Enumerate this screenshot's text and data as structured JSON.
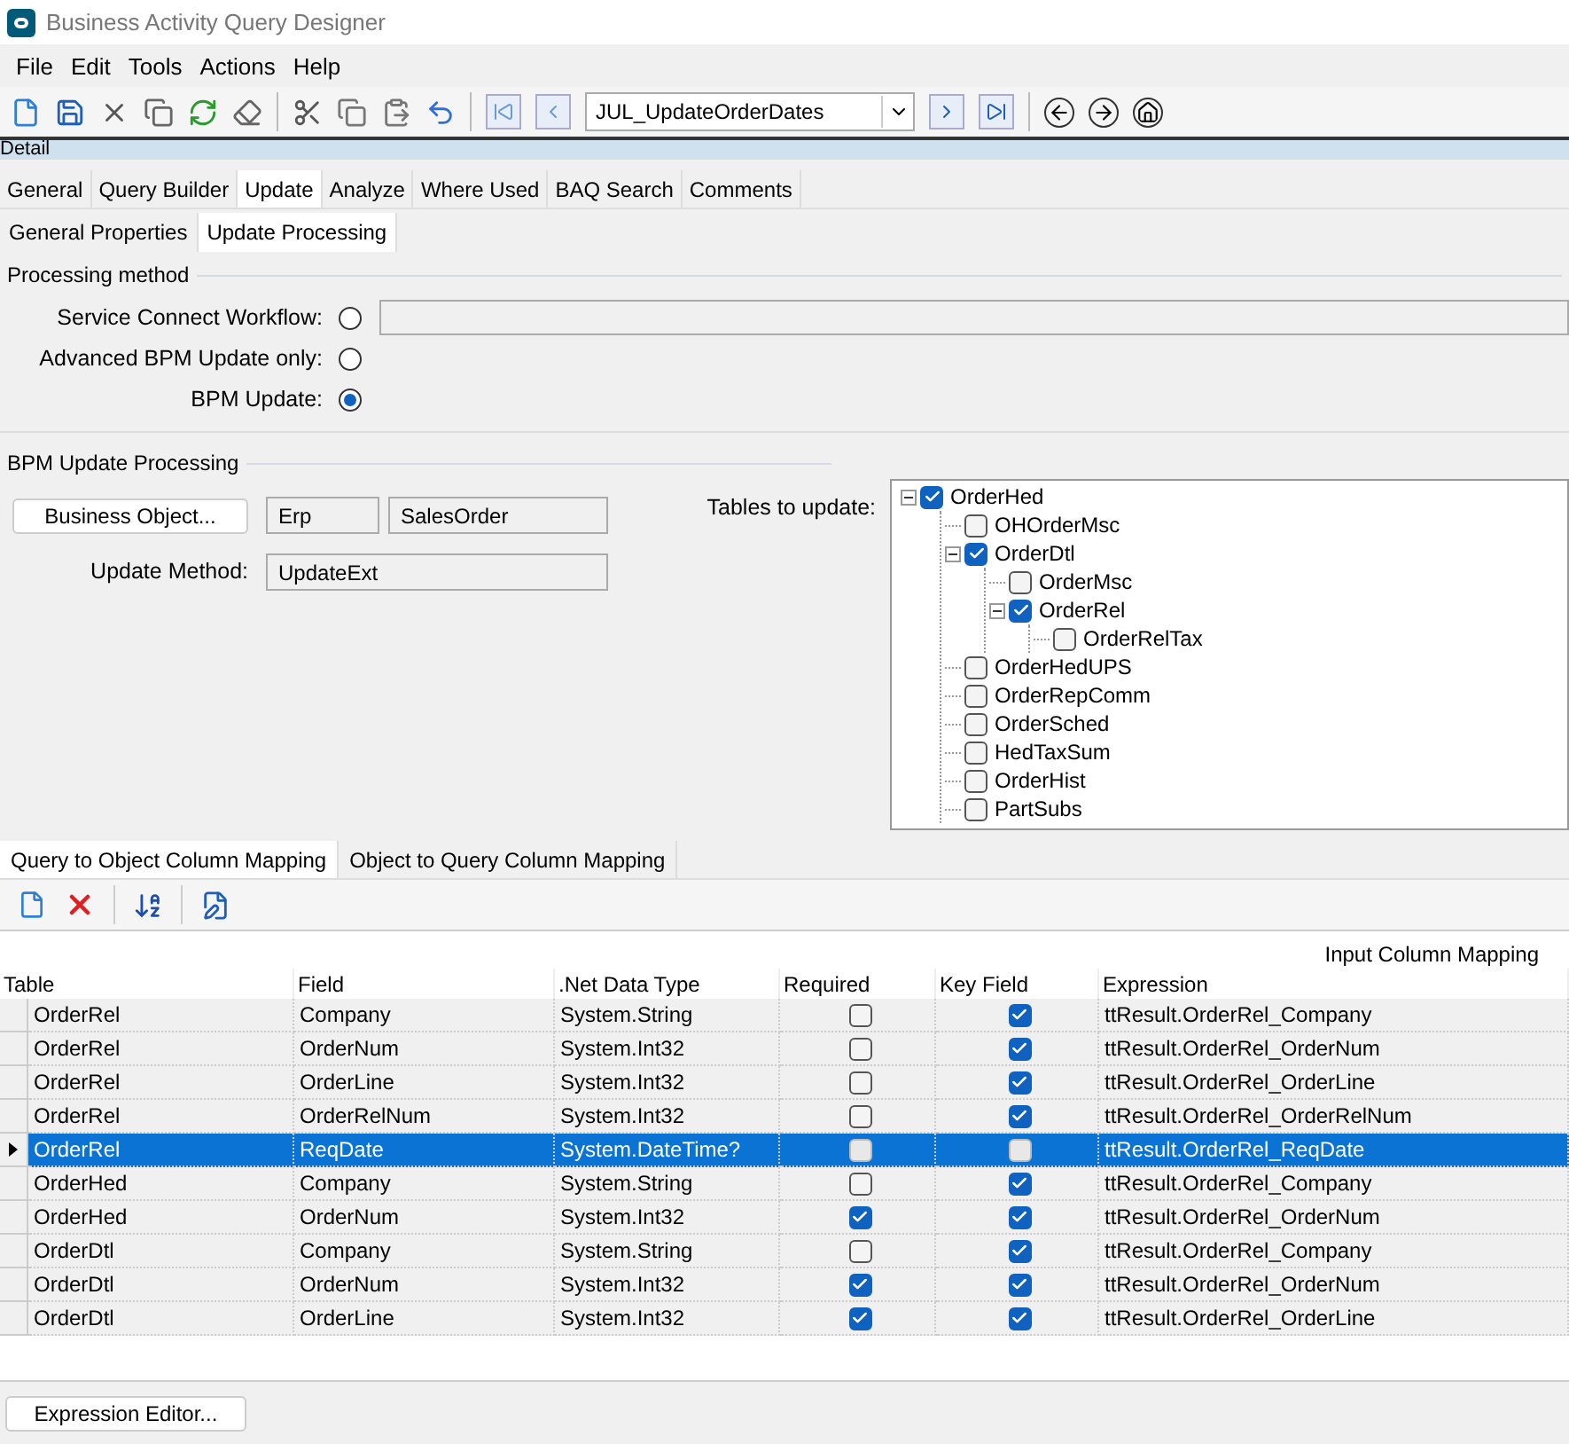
{
  "window": {
    "title": "Business Activity Query Designer"
  },
  "menu": [
    "File",
    "Edit",
    "Tools",
    "Actions",
    "Help"
  ],
  "toolbar": {
    "query_combo": "JUL_UpdateOrderDates"
  },
  "detail_header": "Detail",
  "tabs": [
    {
      "label": "General",
      "selected": false
    },
    {
      "label": "Query Builder",
      "selected": false
    },
    {
      "label": "Update",
      "selected": true
    },
    {
      "label": "Analyze",
      "selected": false
    },
    {
      "label": "Where Used",
      "selected": false
    },
    {
      "label": "BAQ Search",
      "selected": false
    },
    {
      "label": "Comments",
      "selected": false
    }
  ],
  "subtabs": [
    {
      "label": "General Properties",
      "selected": false
    },
    {
      "label": "Update  Processing",
      "selected": true
    }
  ],
  "processing_method": {
    "title": "Processing method",
    "options": [
      {
        "label": "Service Connect Workflow:",
        "selected": false,
        "kind": "with-field"
      },
      {
        "label": "Advanced BPM Update only:",
        "selected": false,
        "kind": "plain"
      },
      {
        "label": "BPM Update:",
        "selected": true,
        "kind": "plain"
      }
    ]
  },
  "bpm_update": {
    "title": "BPM Update Processing",
    "business_object_button": "Business Object...",
    "object_fields": [
      "Erp",
      "SalesOrder"
    ],
    "update_method_label": "Update Method:",
    "update_method": "UpdateExt",
    "tables_label": "Tables to update:",
    "tables": [
      {
        "name": "OrderHed",
        "checked": true,
        "expanded": true,
        "children": [
          {
            "name": "OHOrderMsc",
            "checked": false
          },
          {
            "name": "OrderDtl",
            "checked": true,
            "expanded": true,
            "children": [
              {
                "name": "OrderMsc",
                "checked": false
              },
              {
                "name": "OrderRel",
                "checked": true,
                "expanded": true,
                "children": [
                  {
                    "name": "OrderRelTax",
                    "checked": false
                  }
                ]
              }
            ]
          },
          {
            "name": "OrderHedUPS",
            "checked": false
          },
          {
            "name": "OrderRepComm",
            "checked": false
          },
          {
            "name": "OrderSched",
            "checked": false
          },
          {
            "name": "HedTaxSum",
            "checked": false
          },
          {
            "name": "OrderHist",
            "checked": false
          },
          {
            "name": "PartSubs",
            "checked": false
          }
        ]
      }
    ]
  },
  "mapping_tabs": [
    {
      "label": "Query to Object Column Mapping",
      "selected": true
    },
    {
      "label": "Object to Query Column Mapping",
      "selected": false
    }
  ],
  "grid": {
    "caption": "Input Column Mapping",
    "columns": [
      "Table",
      "Field",
      ".Net Data Type",
      "Required",
      "Key Field",
      "Expression"
    ],
    "rows": [
      {
        "table": "OrderRel",
        "field": "Company",
        "type": "System.String",
        "required": false,
        "key_field": true,
        "expression": "ttResult.OrderRel_Company",
        "selected": false
      },
      {
        "table": "OrderRel",
        "field": "OrderNum",
        "type": "System.Int32",
        "required": false,
        "key_field": true,
        "expression": "ttResult.OrderRel_OrderNum",
        "selected": false
      },
      {
        "table": "OrderRel",
        "field": "OrderLine",
        "type": "System.Int32",
        "required": false,
        "key_field": true,
        "expression": "ttResult.OrderRel_OrderLine",
        "selected": false
      },
      {
        "table": "OrderRel",
        "field": "OrderRelNum",
        "type": "System.Int32",
        "required": false,
        "key_field": true,
        "expression": "ttResult.OrderRel_OrderRelNum",
        "selected": false
      },
      {
        "table": "OrderRel",
        "field": "ReqDate",
        "type": "System.DateTime?",
        "required": false,
        "key_field": false,
        "expression": "ttResult.OrderRel_ReqDate",
        "selected": true
      },
      {
        "table": "OrderHed",
        "field": "Company",
        "type": "System.String",
        "required": false,
        "key_field": true,
        "expression": "ttResult.OrderRel_Company",
        "selected": false
      },
      {
        "table": "OrderHed",
        "field": "OrderNum",
        "type": "System.Int32",
        "required": true,
        "key_field": true,
        "expression": "ttResult.OrderRel_OrderNum",
        "selected": false
      },
      {
        "table": "OrderDtl",
        "field": "Company",
        "type": "System.String",
        "required": false,
        "key_field": true,
        "expression": "ttResult.OrderRel_Company",
        "selected": false
      },
      {
        "table": "OrderDtl",
        "field": "OrderNum",
        "type": "System.Int32",
        "required": true,
        "key_field": true,
        "expression": "ttResult.OrderRel_OrderNum",
        "selected": false
      },
      {
        "table": "OrderDtl",
        "field": "OrderLine",
        "type": "System.Int32",
        "required": true,
        "key_field": true,
        "expression": "ttResult.OrderRel_OrderLine",
        "selected": false
      }
    ]
  },
  "expression_editor_button": "Expression Editor..."
}
